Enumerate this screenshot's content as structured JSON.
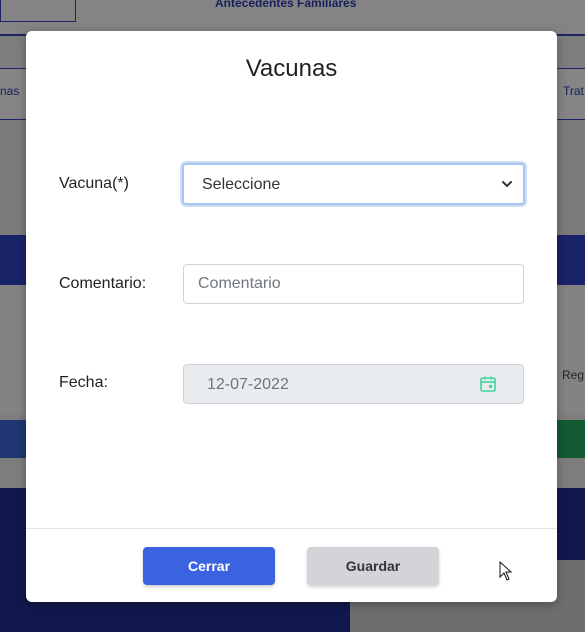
{
  "background": {
    "top_tab_title": "Antecedentes Familiares",
    "left_tab": "nas",
    "right_tab": "Trat",
    "right_label": "Reg"
  },
  "modal": {
    "title": "Vacunas",
    "fields": {
      "vaccine": {
        "label": "Vacuna(*)",
        "value": "Seleccione"
      },
      "comment": {
        "label": "Comentario:",
        "placeholder": "Comentario",
        "value": ""
      },
      "date": {
        "label": "Fecha:",
        "value": "12-07-2022"
      }
    },
    "buttons": {
      "close": "Cerrar",
      "save": "Guardar"
    }
  },
  "colors": {
    "primary": "#3b63e0",
    "secondary": "#d3d4d8",
    "calendar_icon": "#3fd6a0"
  }
}
